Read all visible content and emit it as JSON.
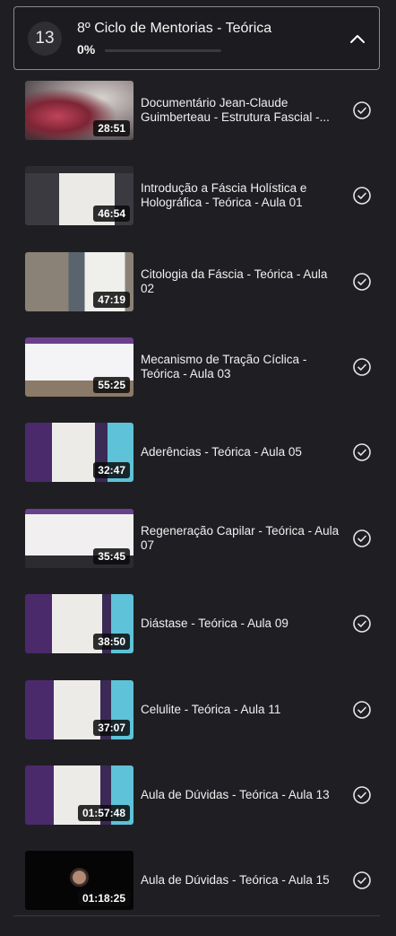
{
  "module": {
    "number": "13",
    "title": "8º Ciclo de Mentorias - Teórica",
    "progress_label": "0%",
    "progress_fraction": 0
  },
  "lessons": [
    {
      "title": "Documentário Jean-Claude Guimberteau - Estrutura Fascial -...",
      "duration": "28:51"
    },
    {
      "title": "Introdução a Fáscia Holística e Holográfica - Teórica - Aula 01",
      "duration": "46:54"
    },
    {
      "title": "Citologia da Fáscia - Teórica - Aula 02",
      "duration": "47:19"
    },
    {
      "title": "Mecanismo de Tração Cíclica - Teórica - Aula 03",
      "duration": "55:25"
    },
    {
      "title": "Aderências - Teórica - Aula 05",
      "duration": "32:47"
    },
    {
      "title": "Regeneração Capilar - Teórica - Aula 07",
      "duration": "35:45"
    },
    {
      "title": "Diástase - Teórica - Aula 09",
      "duration": "38:50"
    },
    {
      "title": "Celulite - Teórica - Aula 11",
      "duration": "37:07"
    },
    {
      "title": "Aula de Dúvidas - Teórica - Aula 13",
      "duration": "01:57:48"
    },
    {
      "title": "Aula de Dúvidas - Teórica - Aula 15",
      "duration": "01:18:25"
    }
  ],
  "icons": {
    "collapse": "chevron-up-icon",
    "completed": "check-circle-icon"
  },
  "colors": {
    "background": "#1f1f23",
    "text": "#f0f0f0",
    "border": "#8a8a8e"
  }
}
